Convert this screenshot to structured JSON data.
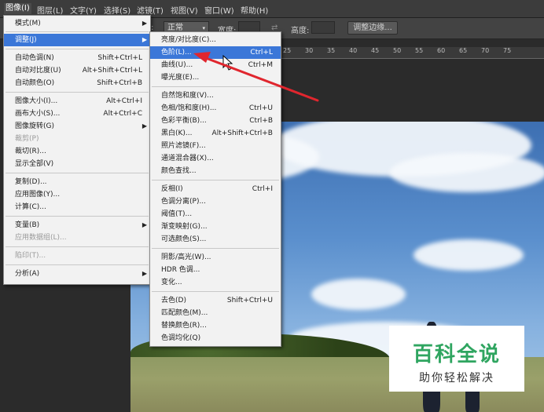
{
  "menubar": {
    "items": [
      "图像(I)",
      "图层(L)",
      "文字(Y)",
      "选择(S)",
      "滤镜(T)",
      "视图(V)",
      "窗口(W)",
      "帮助(H)"
    ]
  },
  "options_bar": {
    "mode_value": "正常",
    "width_label": "宽度:",
    "height_label": "高度:",
    "refine_edge_label": "调整边缘..."
  },
  "image_menu": {
    "items": [
      {
        "label": "模式(M)",
        "shortcut": "",
        "submenu": true,
        "enabled": true
      },
      {
        "label": "调整(J)",
        "shortcut": "",
        "submenu": true,
        "enabled": true,
        "highlighted": true
      },
      {
        "label": "自动色调(N)",
        "shortcut": "Shift+Ctrl+L",
        "enabled": true
      },
      {
        "label": "自动对比度(U)",
        "shortcut": "Alt+Shift+Ctrl+L",
        "enabled": true
      },
      {
        "label": "自动颜色(O)",
        "shortcut": "Shift+Ctrl+B",
        "enabled": true
      },
      {
        "label": "图像大小(I)...",
        "shortcut": "Alt+Ctrl+I",
        "enabled": true
      },
      {
        "label": "画布大小(S)...",
        "shortcut": "Alt+Ctrl+C",
        "enabled": true
      },
      {
        "label": "图像旋转(G)",
        "shortcut": "",
        "submenu": true,
        "enabled": true
      },
      {
        "label": "裁剪(P)",
        "shortcut": "",
        "enabled": false
      },
      {
        "label": "裁切(R)...",
        "shortcut": "",
        "enabled": true
      },
      {
        "label": "显示全部(V)",
        "shortcut": "",
        "enabled": true
      },
      {
        "label": "复制(D)...",
        "shortcut": "",
        "enabled": true
      },
      {
        "label": "应用图像(Y)...",
        "shortcut": "",
        "enabled": true
      },
      {
        "label": "计算(C)...",
        "shortcut": "",
        "enabled": true
      },
      {
        "label": "变量(B)",
        "shortcut": "",
        "submenu": true,
        "enabled": true
      },
      {
        "label": "应用数据组(L)...",
        "shortcut": "",
        "enabled": false
      },
      {
        "label": "陷印(T)...",
        "shortcut": "",
        "enabled": false
      },
      {
        "label": "分析(A)",
        "shortcut": "",
        "submenu": true,
        "enabled": true
      }
    ]
  },
  "adjust_menu": {
    "items": [
      {
        "label": "亮度/对比度(C)...",
        "shortcut": ""
      },
      {
        "label": "色阶(L)...",
        "shortcut": "Ctrl+L",
        "highlighted": true
      },
      {
        "label": "曲线(U)...",
        "shortcut": "Ctrl+M"
      },
      {
        "label": "曝光度(E)...",
        "shortcut": ""
      },
      {
        "label": "自然饱和度(V)...",
        "shortcut": ""
      },
      {
        "label": "色相/饱和度(H)...",
        "shortcut": "Ctrl+U"
      },
      {
        "label": "色彩平衡(B)...",
        "shortcut": "Ctrl+B"
      },
      {
        "label": "黑白(K)...",
        "shortcut": "Alt+Shift+Ctrl+B"
      },
      {
        "label": "照片滤镜(F)...",
        "shortcut": ""
      },
      {
        "label": "通道混合器(X)...",
        "shortcut": ""
      },
      {
        "label": "颜色查找...",
        "shortcut": ""
      },
      {
        "label": "反相(I)",
        "shortcut": "Ctrl+I"
      },
      {
        "label": "色调分离(P)...",
        "shortcut": ""
      },
      {
        "label": "阈值(T)...",
        "shortcut": ""
      },
      {
        "label": "渐变映射(G)...",
        "shortcut": ""
      },
      {
        "label": "可选颜色(S)...",
        "shortcut": ""
      },
      {
        "label": "阴影/高光(W)...",
        "shortcut": ""
      },
      {
        "label": "HDR 色调...",
        "shortcut": ""
      },
      {
        "label": "变化...",
        "shortcut": ""
      },
      {
        "label": "去色(D)",
        "shortcut": "Shift+Ctrl+U"
      },
      {
        "label": "匹配颜色(M)...",
        "shortcut": ""
      },
      {
        "label": "替换颜色(R)...",
        "shortcut": ""
      },
      {
        "label": "色调均化(Q)",
        "shortcut": ""
      }
    ]
  },
  "ruler": {
    "labels": [
      "25",
      "30",
      "35",
      "40",
      "45",
      "50",
      "55",
      "60",
      "65",
      "70",
      "75"
    ]
  },
  "watermark": {
    "title": "百科全说",
    "subtitle": "助你轻松解决"
  },
  "colors": {
    "highlight": "#3b77d8",
    "annotation_arrow": "#e0262e",
    "watermark_green": "#2fa560"
  },
  "icons": {
    "cursor": "arrow-cursor-icon",
    "annotation": "red-arrow-icon"
  }
}
